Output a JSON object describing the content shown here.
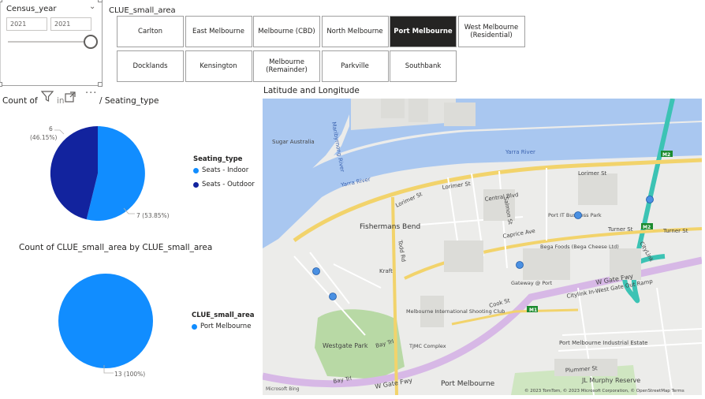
{
  "census_slicer": {
    "title": "Census_year",
    "from_year": "2021",
    "to_year": "2021"
  },
  "area_slicer": {
    "title": "CLUE_small_area",
    "buttons": [
      {
        "label": "Carlton",
        "selected": false
      },
      {
        "label": "East Melbourne",
        "selected": false
      },
      {
        "label": "Melbourne (CBD)",
        "selected": false
      },
      {
        "label": "North Melbourne",
        "selected": false
      },
      {
        "label": "Port Melbourne",
        "selected": true
      },
      {
        "label": "West Melbourne (Residential)",
        "selected": false
      },
      {
        "label": "Docklands",
        "selected": false
      },
      {
        "label": "Kensington",
        "selected": false
      },
      {
        "label": "Melbourne (Remainder)",
        "selected": false
      },
      {
        "label": "Parkville",
        "selected": false
      },
      {
        "label": "Southbank",
        "selected": false
      }
    ]
  },
  "visual_header": {
    "filter_icon": "filter-icon",
    "focus_icon": "focus-mode-icon",
    "more_icon": "more-options-icon"
  },
  "pie1": {
    "title_start": "Count of",
    "title_mid": "in",
    "title_end": "/ Seating_type",
    "legend_title": "Seating_type",
    "legend": [
      {
        "name": "Seats - Indoor",
        "color": "#118dff"
      },
      {
        "name": "Seats - Outdoor",
        "color": "#12239e"
      }
    ],
    "label_outdoor_count": "6",
    "label_outdoor_pct": "(46.15%)",
    "label_indoor": "7 (53.85%)"
  },
  "pie2": {
    "title": "Count of CLUE_small_area by CLUE_small_area",
    "legend_title": "CLUE_small_area",
    "legend": [
      {
        "name": "Port Melbourne",
        "color": "#118dff"
      }
    ],
    "label": "13 (100%)"
  },
  "map": {
    "title": "Latitude and Longitude",
    "labels": {
      "sugar_australia": "Sugar Australia",
      "maribyrnong_river": "Maribyrnong River",
      "yarra_river_1": "Yarra River",
      "yarra_river_2": "Yarra River",
      "fishermans_bend": "Fishermans Bend",
      "lorimer_st_1": "Lorimer St",
      "lorimer_st_2": "Lorimer St",
      "lorimer_st_3": "Lorimer St",
      "central_blvd": "Central Blvd",
      "salmon_st": "Salmon St",
      "todd_rd": "Todd Rd",
      "caprice_ave": "Caprice Ave",
      "turner_st_1": "Turner St",
      "turner_st_2": "Turner St",
      "port_it_business_park": "Port IT Business Park",
      "bega_foods": "Bega Foods (Bega Cheese Ltd)",
      "gateway_port": "Gateway @ Port",
      "w_gate_fwy_1": "W Gate Fwy",
      "w_gate_fwy_2": "W Gate Fwy",
      "citylink_ramp": "Citylink In-West Gate Out Ramp",
      "citylink": "CityLink",
      "kraft": "Kraft",
      "melbourne_shooting_club": "Melbourne International Shooting Club",
      "tjmc_complex": "TJMC Complex",
      "westgate_park": "Westgate Park",
      "bay_trl_1": "Bay Trl",
      "bay_trl_2": "Bay Trl",
      "port_melbourne_industrial": "Port Melbourne Industrial Estate",
      "plummer_st": "Plummer St",
      "jl_murphy_reserve": "JL Murphy Reserve",
      "port_melbourne": "Port Melbourne",
      "cook_st": "Cook St",
      "m1": "M1",
      "m2_1": "M2",
      "m2_2": "M2",
      "attribution": "© 2023 TomTom, © 2023 Microsoft Corporation, © OpenStreetMap  Terms",
      "bing": "Microsoft Bing"
    },
    "points_color": "#4a90e2"
  }
}
